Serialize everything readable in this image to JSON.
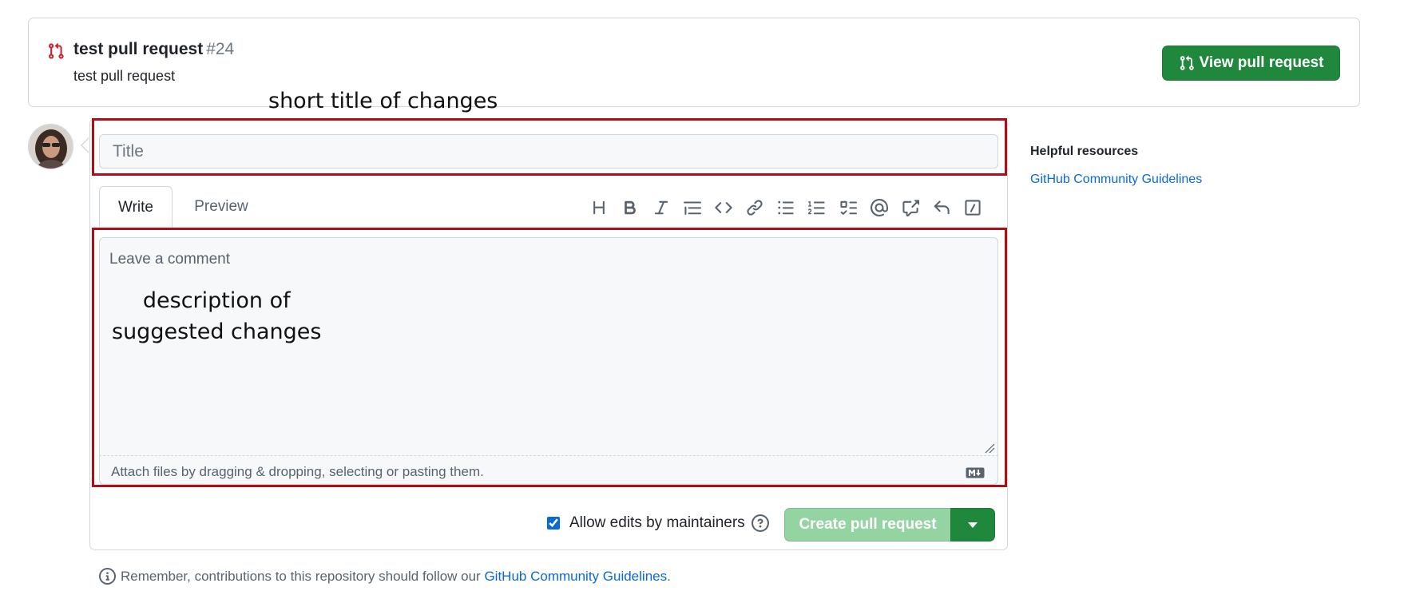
{
  "pr_banner": {
    "title": "test pull request",
    "number": "#24",
    "subtitle": "test pull request",
    "view_button": "View pull request"
  },
  "annotations": {
    "title_note": "short title of changes",
    "desc_note_line1": "description of",
    "desc_note_line2": "suggested changes"
  },
  "form": {
    "title_placeholder": "Title",
    "tabs": {
      "write": "Write",
      "preview": "Preview"
    },
    "toolbar_icons": [
      "heading-icon",
      "bold-icon",
      "italic-icon",
      "quote-icon",
      "code-icon",
      "link-icon",
      "unordered-list-icon",
      "ordered-list-icon",
      "task-list-icon",
      "mention-icon",
      "cross-reference-icon",
      "reply-icon",
      "slash-command-icon"
    ],
    "comment_placeholder": "Leave a comment",
    "attach_text": "Attach files by dragging & dropping, selecting or pasting them.",
    "allow_edits_label": "Allow edits by maintainers",
    "allow_edits_checked": true,
    "create_button": "Create pull request"
  },
  "footer": {
    "note_prefix": "Remember, contributions to this repository should follow our",
    "note_link": "GitHub Community Guidelines",
    "note_suffix": "."
  },
  "sidebar": {
    "title": "Helpful resources",
    "link": "GitHub Community Guidelines"
  },
  "colors": {
    "primary_green": "#1f883d",
    "disabled_green": "#94d3a2",
    "link_blue": "#0969da",
    "annotation_red": "#b00e12",
    "pr_icon_red": "#cf222e"
  }
}
